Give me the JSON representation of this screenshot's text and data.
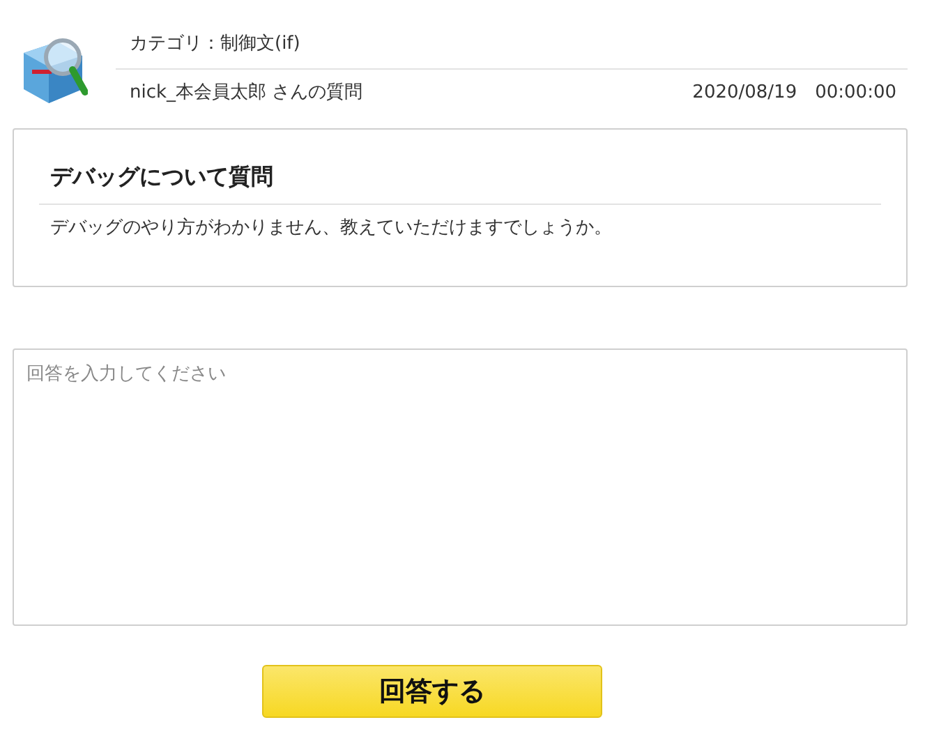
{
  "header": {
    "category": "カテゴリ：制御文(if)",
    "author": "nick_本会員太郎 さんの質問",
    "date": "2020/08/19　00:00:00"
  },
  "question": {
    "title": "デバッグについて質問",
    "body": "デバッグのやり方がわかりません、教えていただけますでしょうか。"
  },
  "answer": {
    "placeholder": "回答を入力してください"
  },
  "submit": {
    "label": "回答する"
  }
}
